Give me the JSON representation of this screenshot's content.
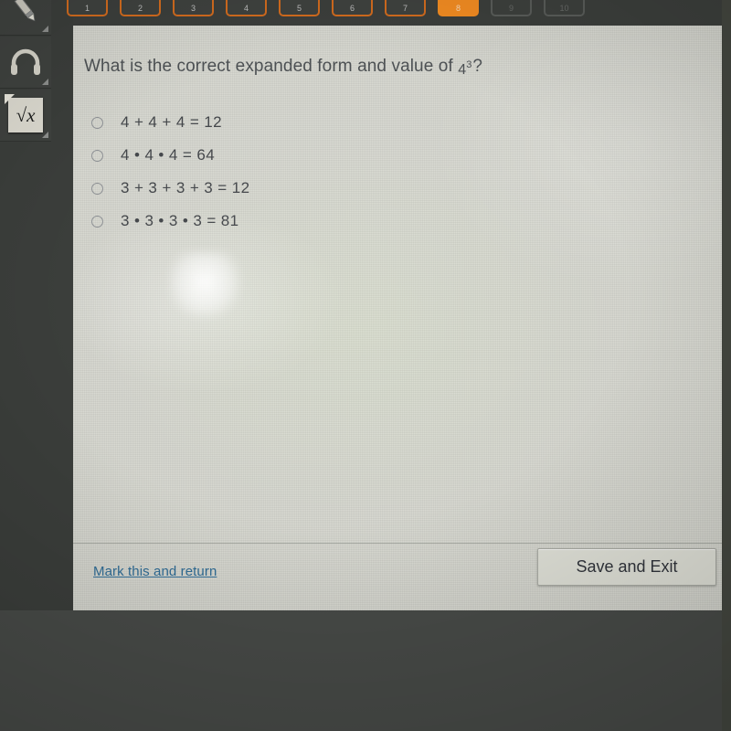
{
  "sidebar": {
    "tools": [
      {
        "name": "pencil-tool",
        "label": "Pencil"
      },
      {
        "name": "headphones-tool",
        "label": "Headphones"
      },
      {
        "name": "calculator-tool",
        "label": "Calculator",
        "symbol": "√x"
      }
    ]
  },
  "nav": {
    "buttons": [
      {
        "label": "1",
        "state": "outline"
      },
      {
        "label": "2",
        "state": "outline"
      },
      {
        "label": "3",
        "state": "outline"
      },
      {
        "label": "4",
        "state": "outline"
      },
      {
        "label": "5",
        "state": "outline"
      },
      {
        "label": "6",
        "state": "outline"
      },
      {
        "label": "7",
        "state": "outline"
      },
      {
        "label": "8",
        "state": "active"
      },
      {
        "label": "9",
        "state": "disabled"
      },
      {
        "label": "10",
        "state": "disabled"
      }
    ]
  },
  "question": {
    "prefix": "What is the correct expanded form and value of ",
    "base": "4",
    "exponent": "3",
    "suffix": "?",
    "full_text": "What is the correct expanded form and value of 4³?"
  },
  "options": [
    {
      "id": "a",
      "text": "4 + 4 + 4 = 12",
      "selected": false
    },
    {
      "id": "b",
      "text": "4 • 4 • 4 = 64",
      "selected": false
    },
    {
      "id": "c",
      "text": "3 + 3 + 3 + 3 = 12",
      "selected": false
    },
    {
      "id": "d",
      "text": "3 • 3 • 3 • 3 = 81",
      "selected": false
    }
  ],
  "footer": {
    "mark_link": "Mark this and return",
    "save_button": "Save and Exit"
  },
  "colors": {
    "accent_orange": "#ef8a21",
    "outline_orange": "#cf6a1e",
    "link_blue": "#2f6b94",
    "panel_bg": "#d6d7cf",
    "chrome_dark": "#3a3d3a",
    "bottom_bar": "#474a47",
    "text_primary": "#43464a"
  }
}
